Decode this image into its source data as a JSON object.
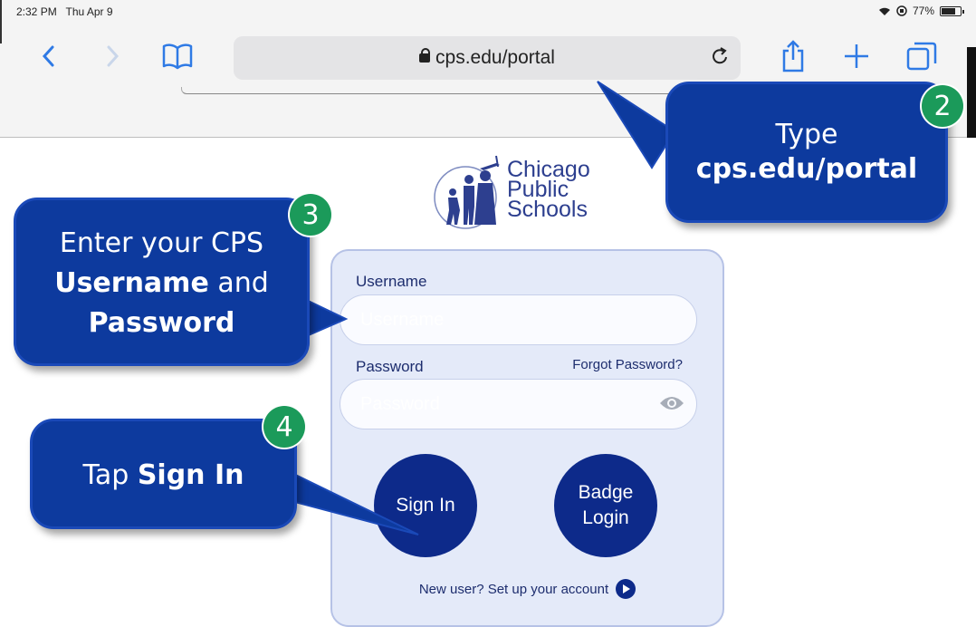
{
  "status_bar": {
    "time": "2:32 PM",
    "date": "Thu Apr 9",
    "battery": "77%"
  },
  "browser": {
    "url": "cps.edu/portal"
  },
  "logo": {
    "line1": "Chicago",
    "line2": "Public",
    "line3": "Schools"
  },
  "login": {
    "username_label": "Username",
    "username_placeholder": "Username",
    "password_label": "Password",
    "password_placeholder": "Password",
    "forgot_link": "Forgot Password?",
    "sign_in": "Sign In",
    "badge_line1": "Badge",
    "badge_line2": "Login",
    "new_user": "New user? Set up your account"
  },
  "callouts": {
    "step2": {
      "number": "2",
      "line1": "Type",
      "line2": "cps.edu/portal"
    },
    "step3": {
      "number": "3",
      "line1": "Enter your CPS",
      "bold1": "Username",
      "plain": " and",
      "bold2": "Password"
    },
    "step4": {
      "number": "4",
      "prefix": "Tap ",
      "bold": "Sign In"
    }
  },
  "colors": {
    "navy": "#0d2a8a",
    "callout_blue": "#0d3a9e",
    "badge_green": "#1b9a5a",
    "safari_blue": "#2f7ae5"
  }
}
